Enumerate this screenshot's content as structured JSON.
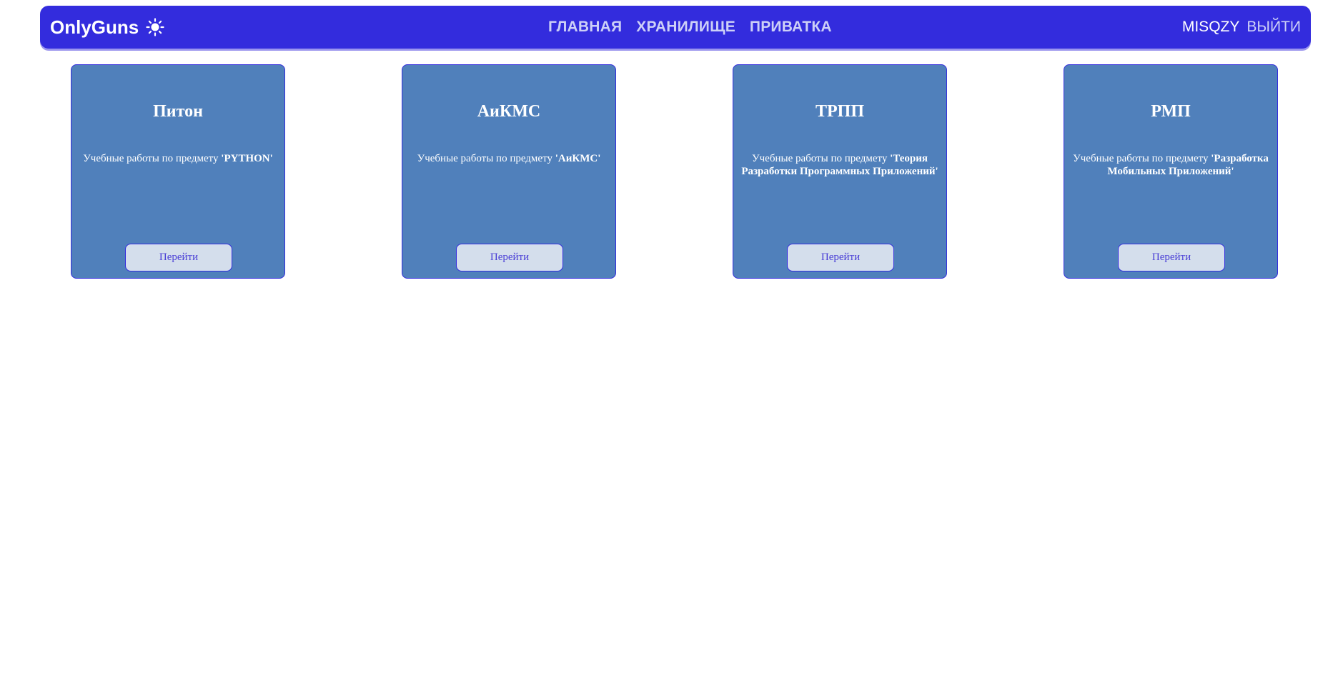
{
  "header": {
    "brand": "OnlyGuns",
    "theme_icon": "sun-icon",
    "nav": [
      "ГЛАВНАЯ",
      "ХРАНИЛИЩЕ",
      "ПРИВАТКА"
    ],
    "username": "MISQZY",
    "logout": "ВЫЙТИ"
  },
  "colors": {
    "navbar": "#332cdd",
    "card": "#5080bb",
    "button": "#d4deec",
    "nav_link": "#cdd0f7"
  },
  "cards": [
    {
      "title": "Питон",
      "desc_prefix": "Учебные работы по предмету ",
      "subject": "'PYTHON'",
      "button": "Перейти"
    },
    {
      "title": "АиКМС",
      "desc_prefix": "Учебные работы по предмету ",
      "subject": "'АиКМС'",
      "button": "Перейти"
    },
    {
      "title": "ТРПП",
      "desc_prefix": "Учебные работы по предмету ",
      "subject": "'Теория Разработки Программных Приложений'",
      "button": "Перейти"
    },
    {
      "title": "РМП",
      "desc_prefix": "Учебные работы по предмету ",
      "subject": "'Разработка Мобильных Приложений'",
      "button": "Перейти"
    }
  ]
}
